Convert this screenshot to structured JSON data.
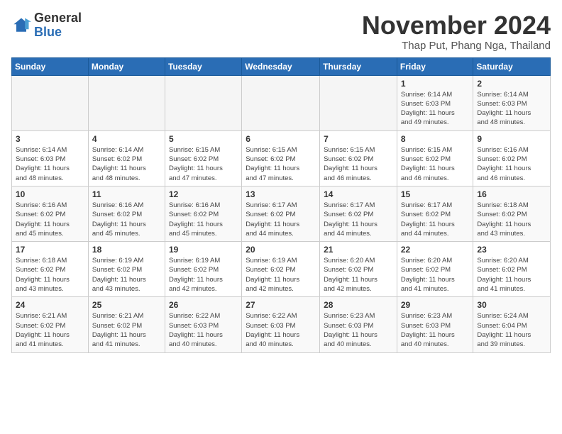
{
  "header": {
    "logo_general": "General",
    "logo_blue": "Blue",
    "month_title": "November 2024",
    "location": "Thap Put, Phang Nga, Thailand"
  },
  "weekdays": [
    "Sunday",
    "Monday",
    "Tuesday",
    "Wednesday",
    "Thursday",
    "Friday",
    "Saturday"
  ],
  "weeks": [
    [
      {
        "day": "",
        "info": ""
      },
      {
        "day": "",
        "info": ""
      },
      {
        "day": "",
        "info": ""
      },
      {
        "day": "",
        "info": ""
      },
      {
        "day": "",
        "info": ""
      },
      {
        "day": "1",
        "info": "Sunrise: 6:14 AM\nSunset: 6:03 PM\nDaylight: 11 hours\nand 49 minutes."
      },
      {
        "day": "2",
        "info": "Sunrise: 6:14 AM\nSunset: 6:03 PM\nDaylight: 11 hours\nand 48 minutes."
      }
    ],
    [
      {
        "day": "3",
        "info": "Sunrise: 6:14 AM\nSunset: 6:03 PM\nDaylight: 11 hours\nand 48 minutes."
      },
      {
        "day": "4",
        "info": "Sunrise: 6:14 AM\nSunset: 6:02 PM\nDaylight: 11 hours\nand 48 minutes."
      },
      {
        "day": "5",
        "info": "Sunrise: 6:15 AM\nSunset: 6:02 PM\nDaylight: 11 hours\nand 47 minutes."
      },
      {
        "day": "6",
        "info": "Sunrise: 6:15 AM\nSunset: 6:02 PM\nDaylight: 11 hours\nand 47 minutes."
      },
      {
        "day": "7",
        "info": "Sunrise: 6:15 AM\nSunset: 6:02 PM\nDaylight: 11 hours\nand 46 minutes."
      },
      {
        "day": "8",
        "info": "Sunrise: 6:15 AM\nSunset: 6:02 PM\nDaylight: 11 hours\nand 46 minutes."
      },
      {
        "day": "9",
        "info": "Sunrise: 6:16 AM\nSunset: 6:02 PM\nDaylight: 11 hours\nand 46 minutes."
      }
    ],
    [
      {
        "day": "10",
        "info": "Sunrise: 6:16 AM\nSunset: 6:02 PM\nDaylight: 11 hours\nand 45 minutes."
      },
      {
        "day": "11",
        "info": "Sunrise: 6:16 AM\nSunset: 6:02 PM\nDaylight: 11 hours\nand 45 minutes."
      },
      {
        "day": "12",
        "info": "Sunrise: 6:16 AM\nSunset: 6:02 PM\nDaylight: 11 hours\nand 45 minutes."
      },
      {
        "day": "13",
        "info": "Sunrise: 6:17 AM\nSunset: 6:02 PM\nDaylight: 11 hours\nand 44 minutes."
      },
      {
        "day": "14",
        "info": "Sunrise: 6:17 AM\nSunset: 6:02 PM\nDaylight: 11 hours\nand 44 minutes."
      },
      {
        "day": "15",
        "info": "Sunrise: 6:17 AM\nSunset: 6:02 PM\nDaylight: 11 hours\nand 44 minutes."
      },
      {
        "day": "16",
        "info": "Sunrise: 6:18 AM\nSunset: 6:02 PM\nDaylight: 11 hours\nand 43 minutes."
      }
    ],
    [
      {
        "day": "17",
        "info": "Sunrise: 6:18 AM\nSunset: 6:02 PM\nDaylight: 11 hours\nand 43 minutes."
      },
      {
        "day": "18",
        "info": "Sunrise: 6:19 AM\nSunset: 6:02 PM\nDaylight: 11 hours\nand 43 minutes."
      },
      {
        "day": "19",
        "info": "Sunrise: 6:19 AM\nSunset: 6:02 PM\nDaylight: 11 hours\nand 42 minutes."
      },
      {
        "day": "20",
        "info": "Sunrise: 6:19 AM\nSunset: 6:02 PM\nDaylight: 11 hours\nand 42 minutes."
      },
      {
        "day": "21",
        "info": "Sunrise: 6:20 AM\nSunset: 6:02 PM\nDaylight: 11 hours\nand 42 minutes."
      },
      {
        "day": "22",
        "info": "Sunrise: 6:20 AM\nSunset: 6:02 PM\nDaylight: 11 hours\nand 41 minutes."
      },
      {
        "day": "23",
        "info": "Sunrise: 6:20 AM\nSunset: 6:02 PM\nDaylight: 11 hours\nand 41 minutes."
      }
    ],
    [
      {
        "day": "24",
        "info": "Sunrise: 6:21 AM\nSunset: 6:02 PM\nDaylight: 11 hours\nand 41 minutes."
      },
      {
        "day": "25",
        "info": "Sunrise: 6:21 AM\nSunset: 6:02 PM\nDaylight: 11 hours\nand 41 minutes."
      },
      {
        "day": "26",
        "info": "Sunrise: 6:22 AM\nSunset: 6:03 PM\nDaylight: 11 hours\nand 40 minutes."
      },
      {
        "day": "27",
        "info": "Sunrise: 6:22 AM\nSunset: 6:03 PM\nDaylight: 11 hours\nand 40 minutes."
      },
      {
        "day": "28",
        "info": "Sunrise: 6:23 AM\nSunset: 6:03 PM\nDaylight: 11 hours\nand 40 minutes."
      },
      {
        "day": "29",
        "info": "Sunrise: 6:23 AM\nSunset: 6:03 PM\nDaylight: 11 hours\nand 40 minutes."
      },
      {
        "day": "30",
        "info": "Sunrise: 6:24 AM\nSunset: 6:04 PM\nDaylight: 11 hours\nand 39 minutes."
      }
    ]
  ]
}
